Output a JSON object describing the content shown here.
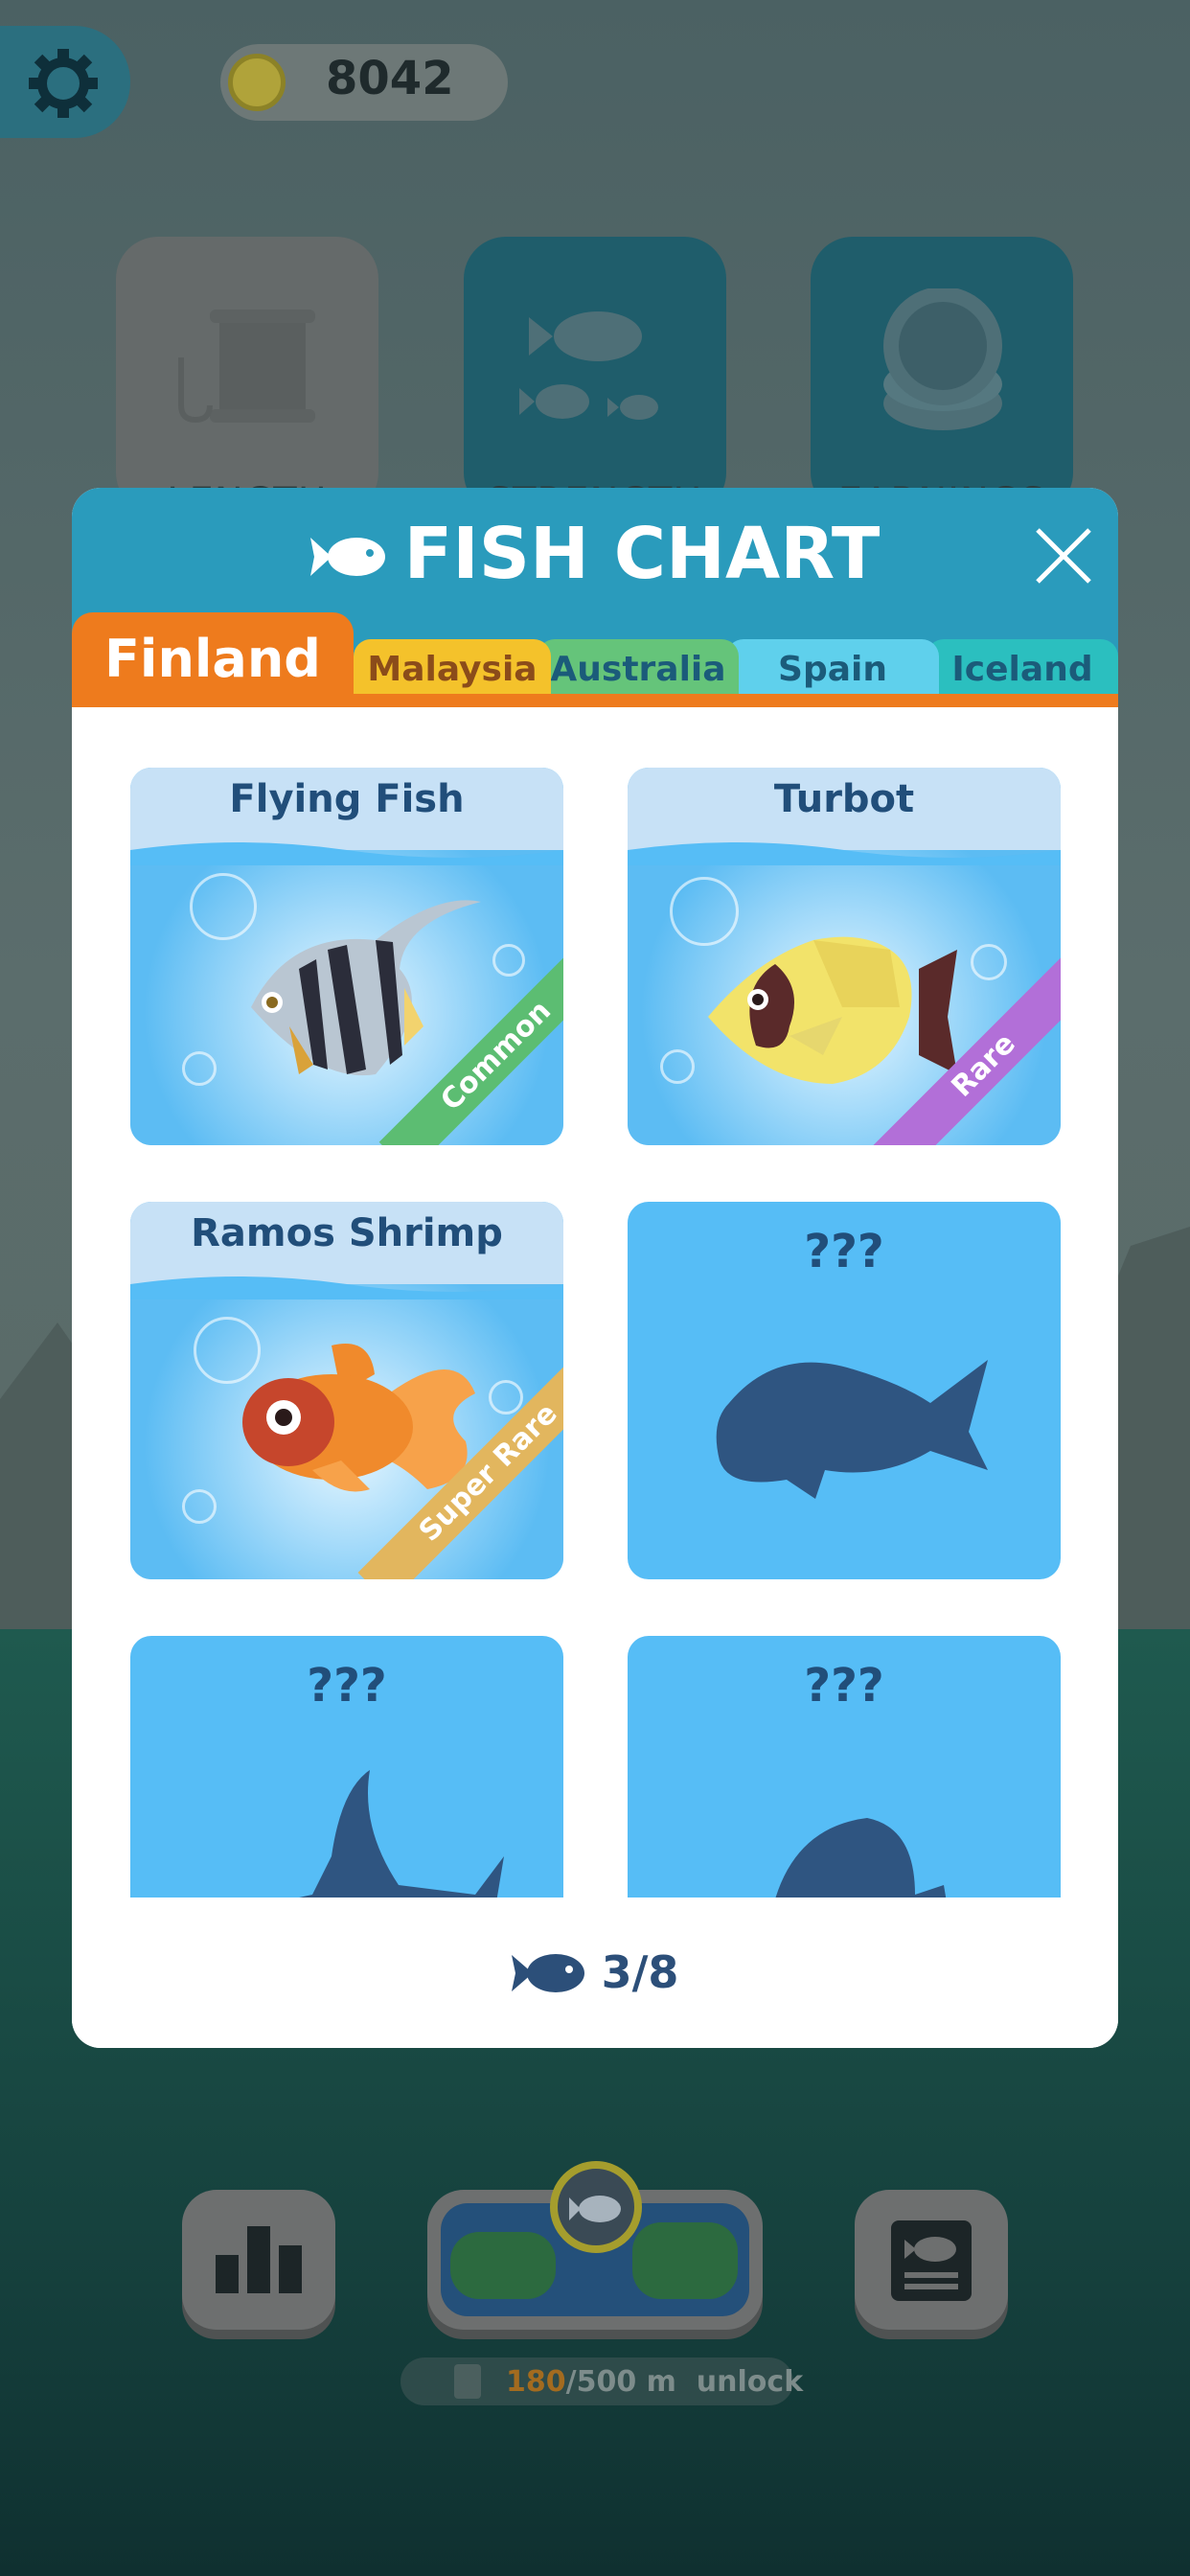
{
  "header": {
    "coins": "8042"
  },
  "upgrades": [
    {
      "label": "LENGTH"
    },
    {
      "label": "STRENGTH"
    },
    {
      "label": "EARNINGS"
    }
  ],
  "dialog": {
    "title": "FISH CHART",
    "tabs": [
      {
        "label": "Finland",
        "color": "#ee7b1d",
        "active": true
      },
      {
        "label": "Malaysia",
        "color": "#f4c22b"
      },
      {
        "label": "Australia",
        "color": "#65c47a"
      },
      {
        "label": "Spain",
        "color": "#5fd0ec"
      },
      {
        "label": "Iceland",
        "color": "#2bbfbf"
      }
    ],
    "cards": [
      {
        "name": "Flying Fish",
        "rarity": "Common"
      },
      {
        "name": "Turbot",
        "rarity": "Rare"
      },
      {
        "name": "Ramos Shrimp",
        "rarity": "Super Rare"
      },
      {
        "name": "???"
      },
      {
        "name": "???"
      },
      {
        "name": "???"
      }
    ],
    "counter": "3/8"
  },
  "unlock": {
    "current": "180",
    "rest": "/500 m  unlock"
  },
  "icons": [
    "gear-icon",
    "coin-icon",
    "fish-icon",
    "close-icon",
    "bar-chart-icon",
    "map-pin-icon",
    "book-icon",
    "spool-icon"
  ]
}
